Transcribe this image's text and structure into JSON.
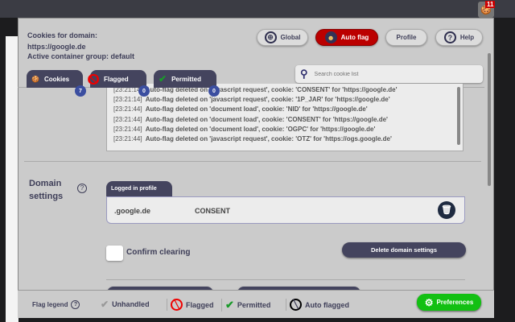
{
  "browser": {
    "extension_badge": "11"
  },
  "header": {
    "line1": "Cookies for domain:",
    "domain": "https://google.de",
    "container": "Active container group: default"
  },
  "nav": {
    "global": "Global",
    "autoflag": "Auto flag",
    "profile": "Profile",
    "help": "Help"
  },
  "search": {
    "placeholder": "Search cookie list"
  },
  "tabs": [
    {
      "label": "Cookies",
      "count": "7"
    },
    {
      "label": "Flagged",
      "count": "0"
    },
    {
      "label": "Permitted",
      "count": "0"
    }
  ],
  "log": [
    {
      "time": "[23:21:14]",
      "msg": "Auto-flag deleted on 'javascript request', cookie: 'CONSENT' for 'https://google.de'"
    },
    {
      "time": "[23:21:14]",
      "msg": "Auto-flag deleted on 'javascript request', cookie: '1P_JAR' for 'https://google.de'"
    },
    {
      "time": "[23:21:44]",
      "msg": "Auto-flag deleted on 'document load', cookie: 'NID' for 'https://google.de'"
    },
    {
      "time": "[23:21:44]",
      "msg": "Auto-flag deleted on 'document load', cookie: 'CONSENT' for 'https://google.de'"
    },
    {
      "time": "[23:21:44]",
      "msg": "Auto-flag deleted on 'document load', cookie: 'OGPC' for 'https://google.de'"
    },
    {
      "time": "[23:21:44]",
      "msg": "Auto-flag deleted on 'javascript request', cookie: 'OTZ' for 'https://ogs.google.de'"
    }
  ],
  "domain_settings": {
    "title_line1": "Domain",
    "title_line2": "settings",
    "help": "?",
    "tab": "Logged in profile",
    "row": {
      "domain": ".google.de",
      "cookie": "CONSENT"
    },
    "confirm": "Confirm clearing",
    "delete_btn": "Delete domain settings"
  },
  "footer": {
    "legend": "Flag legend",
    "help": "?",
    "unhandled": "Unhandled",
    "flagged": "Flagged",
    "permitted": "Permitted",
    "autoflagged": "Auto flagged",
    "preferences": "Preferences"
  }
}
